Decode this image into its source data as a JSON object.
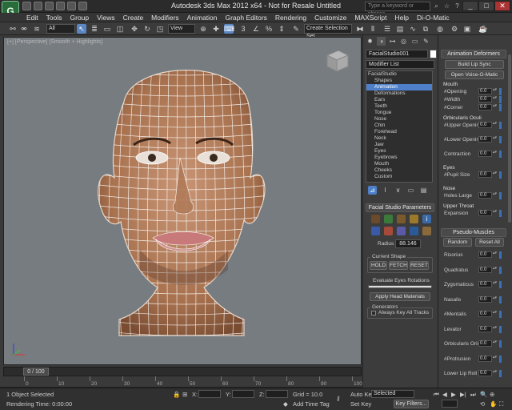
{
  "window": {
    "title": "Autodesk 3ds Max  2012 x64   -  Not for Resale    Untitled",
    "app_icon": "3ds-max-logo-icon",
    "search_placeholder": "Type a keyword or phrase",
    "controls": [
      "_",
      "□",
      "✕"
    ]
  },
  "menubar": {
    "items": [
      "Edit",
      "Tools",
      "Group",
      "Views",
      "Create",
      "Modifiers",
      "Animation",
      "Graph Editors",
      "Rendering",
      "Customize",
      "MAXScript",
      "Help",
      "Di-O-Matic"
    ]
  },
  "toolbar": {
    "selection_filter": "All",
    "ref_coord": "View",
    "named_selection": "Create Selection Set"
  },
  "viewport": {
    "label": "[+] [Perspective] [Smooth + Highlights]",
    "background": "#777c80",
    "skin_color": "#b98866",
    "mesh_color": "#ffffff"
  },
  "timeslider": {
    "position": "0 / 100",
    "ticks": [
      "0",
      "10",
      "20",
      "30",
      "40",
      "50",
      "60",
      "70",
      "80",
      "90",
      "100"
    ]
  },
  "statusbar": {
    "selection": "1 Object Selected",
    "render_time": "Rendering Time:  0:00:00",
    "x_label": "X:",
    "y_label": "Y:",
    "z_label": "Z:",
    "grid": "Grid = 10.0",
    "add_time_tag": "Add Time Tag",
    "auto_key": "Auto Key",
    "set_key": "Set Key",
    "key_mode": "Selected",
    "key_filters": "Key Filters..."
  },
  "command_panel": {
    "object_name": "FacialStudio001",
    "modifier_list": "Modifier List",
    "stack": {
      "root": "FacialStudio",
      "items": [
        "Shapes",
        "Animation",
        "Deformations",
        "Ears",
        "Teeth",
        "Tongue",
        "Nose",
        "Chin",
        "Forehead",
        "Neck",
        "Jaw",
        "Eyes",
        "Eyebrows",
        "Mouth",
        "Cheeks",
        "Custom"
      ],
      "selected_index": 1
    },
    "facial_params_title": "Facial Studio Parameters",
    "radius_label": "Radius :",
    "radius_value": "88.146",
    "current_shape_title": "Current Shape",
    "hold": "HOLD",
    "fetch": "FETCH",
    "reset": "RESET",
    "evaluate_eyes": "Evaluate Eyes Rotations",
    "apply_head": "Apply Head Materials",
    "generators_title": "Generators",
    "always_key": "Always Key All Tracks"
  },
  "right_panel": {
    "animation_deformers": "Animation Deformers",
    "build_lip_sync": "Build Lip Sync",
    "open_voice": "Open Voice-O-Matic",
    "mouth_title": "Mouth",
    "mouth_items": [
      "#Opening",
      "#Width",
      "#Corner"
    ],
    "orbicularis_title": "Orbicularis Oculi",
    "orbicularis_items": [
      "#Upper Opening",
      "#Lower Opening",
      "Contraction"
    ],
    "eyes_title": "Eyes",
    "eyes_items": [
      "#Pupil Size"
    ],
    "nose_title": "Nose",
    "nose_items": [
      "Holes Large"
    ],
    "throat_title": "Upper Throat",
    "throat_items": [
      "Expansion"
    ],
    "pseudo_muscles": "Pseudo-Muscles",
    "random": "Random",
    "reset_all": "Reset All",
    "muscles": [
      "Risorius",
      "Quadratus",
      "Zygomaticus",
      "Nasalis",
      "#Mentalis",
      "Levator",
      "Orbicularis Oris",
      "#Protrusion",
      "Lower Lip Roll"
    ],
    "spinner_value": "0.0"
  }
}
